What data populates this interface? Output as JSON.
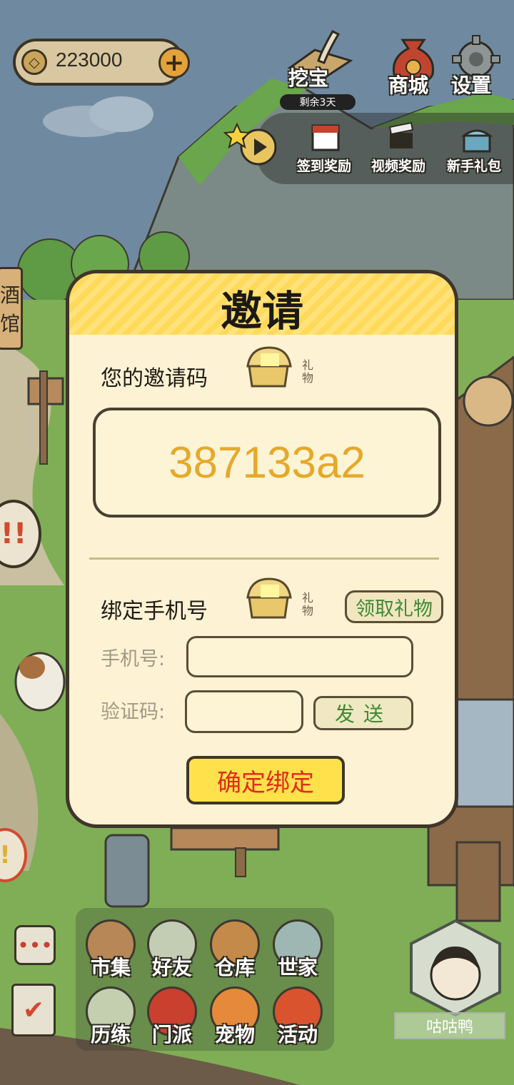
{
  "currency": {
    "amount": "223000"
  },
  "top_icons": {
    "treasure": "挖宝",
    "treasure_remaining": "剩余3天",
    "shop": "商城",
    "settings": "设置"
  },
  "reward_row": {
    "signin": "签到奖励",
    "video": "视频奖励",
    "newbie": "新手礼包"
  },
  "side": {
    "tavern_line1": "酒",
    "tavern_line2": "馆"
  },
  "dialog": {
    "title": "邀请",
    "invite_label": "您的邀请码",
    "gift_label": "礼物",
    "invite_code": "387133a2",
    "bind_label": "绑定手机号",
    "claim_gift": "领取礼物",
    "phone_label": "手机号:",
    "phone_value": "",
    "code_label": "验证码:",
    "code_value": "",
    "send": "发送",
    "confirm": "确定绑定"
  },
  "menu": {
    "items": [
      {
        "label": "市集"
      },
      {
        "label": "好友"
      },
      {
        "label": "仓库"
      },
      {
        "label": "世家"
      },
      {
        "label": "历练"
      },
      {
        "label": "门派"
      },
      {
        "label": "宠物"
      },
      {
        "label": "活动"
      }
    ]
  },
  "player": {
    "name": "咕咕鸭"
  }
}
